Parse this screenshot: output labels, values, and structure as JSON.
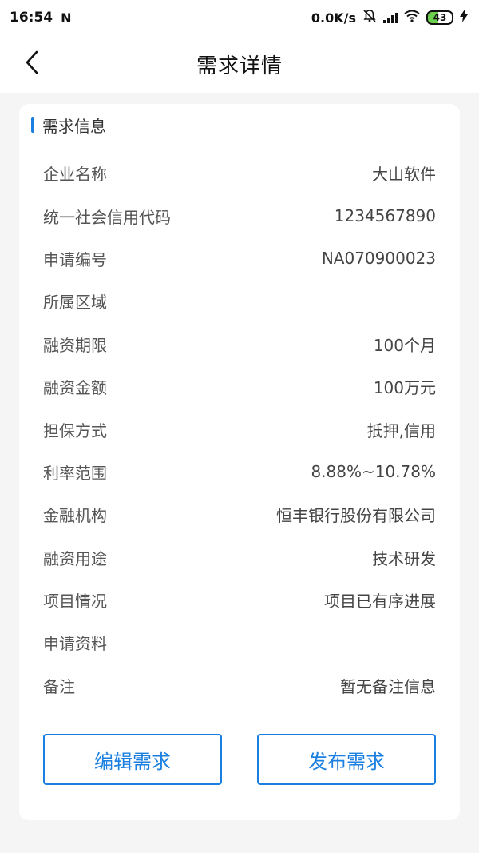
{
  "status_bar": {
    "time": "16:54",
    "notification_glyph": "N",
    "network_speed": "0.0K/s",
    "battery_level": "43",
    "icons": [
      "notification-n-icon",
      "mute-bell-icon",
      "signal-icon",
      "wifi-icon",
      "battery-icon",
      "charging-icon"
    ]
  },
  "nav": {
    "title": "需求详情",
    "back_icon": "chevron-left-icon"
  },
  "section": {
    "title": "需求信息",
    "accent_color": "#1a7fe0"
  },
  "rows": [
    {
      "label": "企业名称",
      "value": "大山软件"
    },
    {
      "label": "统一社会信用代码",
      "value": "1234567890"
    },
    {
      "label": "申请编号",
      "value": "NA070900023"
    },
    {
      "label": "所属区域",
      "value": ""
    },
    {
      "label": "融资期限",
      "value": "100个月"
    },
    {
      "label": "融资金额",
      "value": "100万元"
    },
    {
      "label": "担保方式",
      "value": "抵押,信用"
    },
    {
      "label": "利率范围",
      "value": "8.88%~10.78%"
    },
    {
      "label": "金融机构",
      "value": "恒丰银行股份有限公司"
    },
    {
      "label": "融资用途",
      "value": "技术研发"
    },
    {
      "label": "项目情况",
      "value": "项目已有序进展"
    },
    {
      "label": "申请资料",
      "value": ""
    },
    {
      "label": "备注",
      "value": "暂无备注信息"
    }
  ],
  "actions": {
    "edit_label": "编辑需求",
    "publish_label": "发布需求"
  },
  "colors": {
    "brand": "#1a7fe0",
    "background": "#f5f5f5"
  }
}
